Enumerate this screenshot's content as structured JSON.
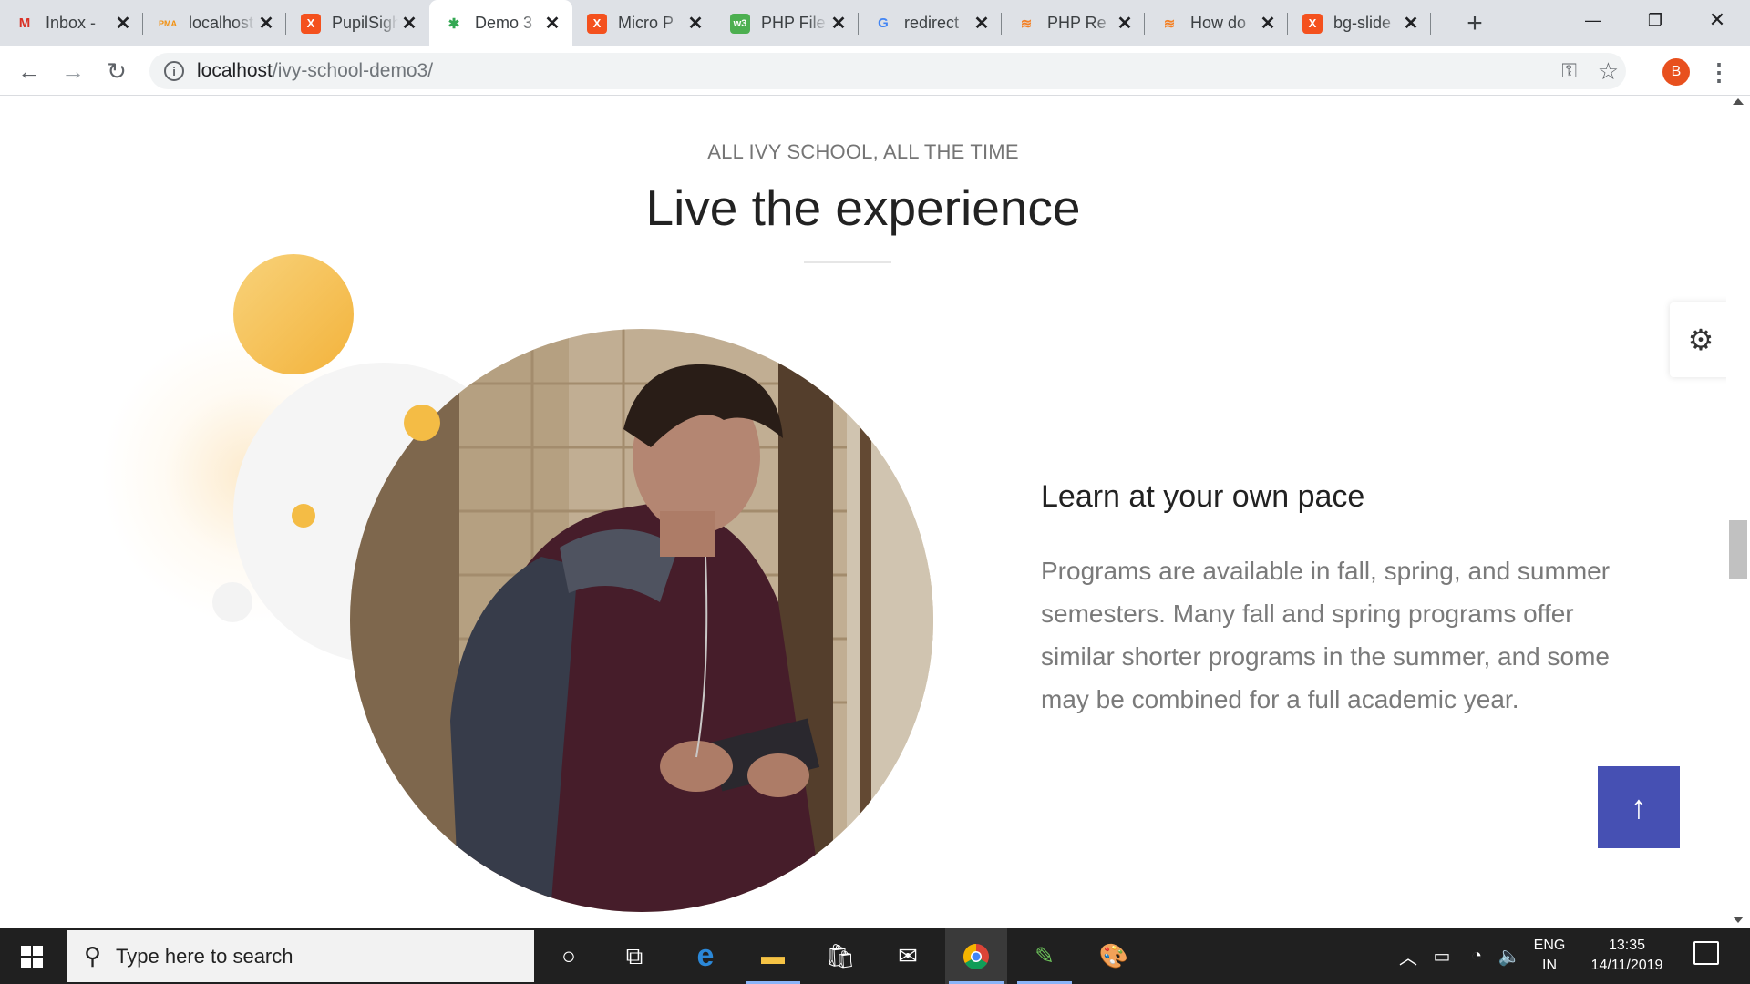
{
  "browser": {
    "tabs": [
      {
        "title": "Inbox - ",
        "favicon": "M",
        "favicon_color": "#d93025",
        "active": false
      },
      {
        "title": "localhost",
        "favicon": "PMA",
        "favicon_color": "#f29111",
        "active": false
      },
      {
        "title": "PupilSight",
        "favicon": "X",
        "favicon_color": "#f4511e",
        "active": false
      },
      {
        "title": "Demo 3",
        "favicon": "✱",
        "favicon_color": "#34a853",
        "active": true
      },
      {
        "title": "Micro P",
        "favicon": "X",
        "favicon_color": "#f4511e",
        "active": false
      },
      {
        "title": "PHP File",
        "favicon": "w3",
        "favicon_color": "#4caf50",
        "active": false
      },
      {
        "title": "redirect",
        "favicon": "G",
        "favicon_color": "#4285f4",
        "active": false
      },
      {
        "title": "PHP Re",
        "favicon": "≋",
        "favicon_color": "#f48024",
        "active": false
      },
      {
        "title": "How do",
        "favicon": "≋",
        "favicon_color": "#f48024",
        "active": false
      },
      {
        "title": "bg-slide",
        "favicon": "X",
        "favicon_color": "#f4511e",
        "active": false
      }
    ],
    "new_tab": "+",
    "window_controls": {
      "minimize": "—",
      "restore": "❐",
      "close": "✕"
    },
    "url_host": "localhost",
    "url_path": "/ivy-school-demo3/",
    "profile_initial": "B",
    "profile_color": "#e8501e"
  },
  "page": {
    "eyebrow": "ALL IVY SCHOOL, ALL THE TIME",
    "heading": "Live the experience",
    "section_title": "Learn at your own pace",
    "section_text": "Programs are available in fall, spring, and summer semesters. Many fall and spring programs offer similar shorter programs in the summer, and some may be combined for a full academic year.",
    "accent_color": "#f4bc45",
    "to_top_color": "#4650b3",
    "to_top_icon": "arrow-up-icon",
    "settings_icon": "gear-icon"
  },
  "taskbar": {
    "search_placeholder": "Type here to search",
    "lang_top": "ENG",
    "lang_bottom": "IN",
    "time": "13:35",
    "date": "14/11/2019"
  }
}
